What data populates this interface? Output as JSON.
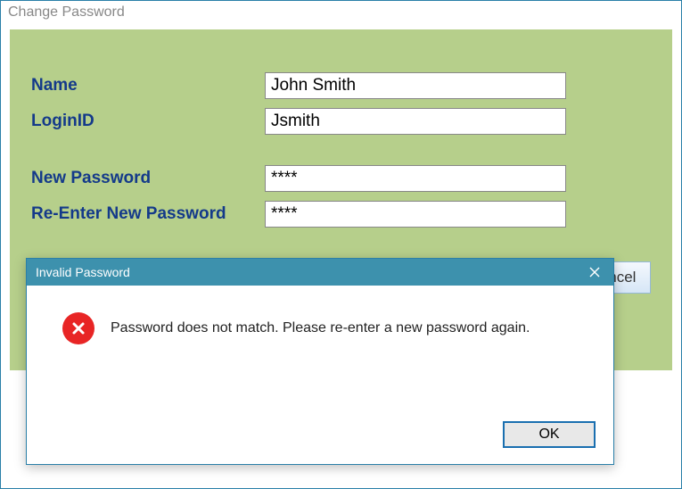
{
  "window": {
    "title": "Change Password"
  },
  "form": {
    "name_label": "Name",
    "name_value": "John Smith",
    "login_label": "LoginID",
    "login_value": "Jsmith",
    "newpass_label": "New Password",
    "newpass_value": "****",
    "repass_label": "Re-Enter New Password",
    "repass_value": "****"
  },
  "buttons": {
    "ok": "OK",
    "cancel": "Cancel"
  },
  "dialog": {
    "title": "Invalid Password",
    "message": "Password does not match. Please re-enter a new password again.",
    "ok": "OK"
  }
}
